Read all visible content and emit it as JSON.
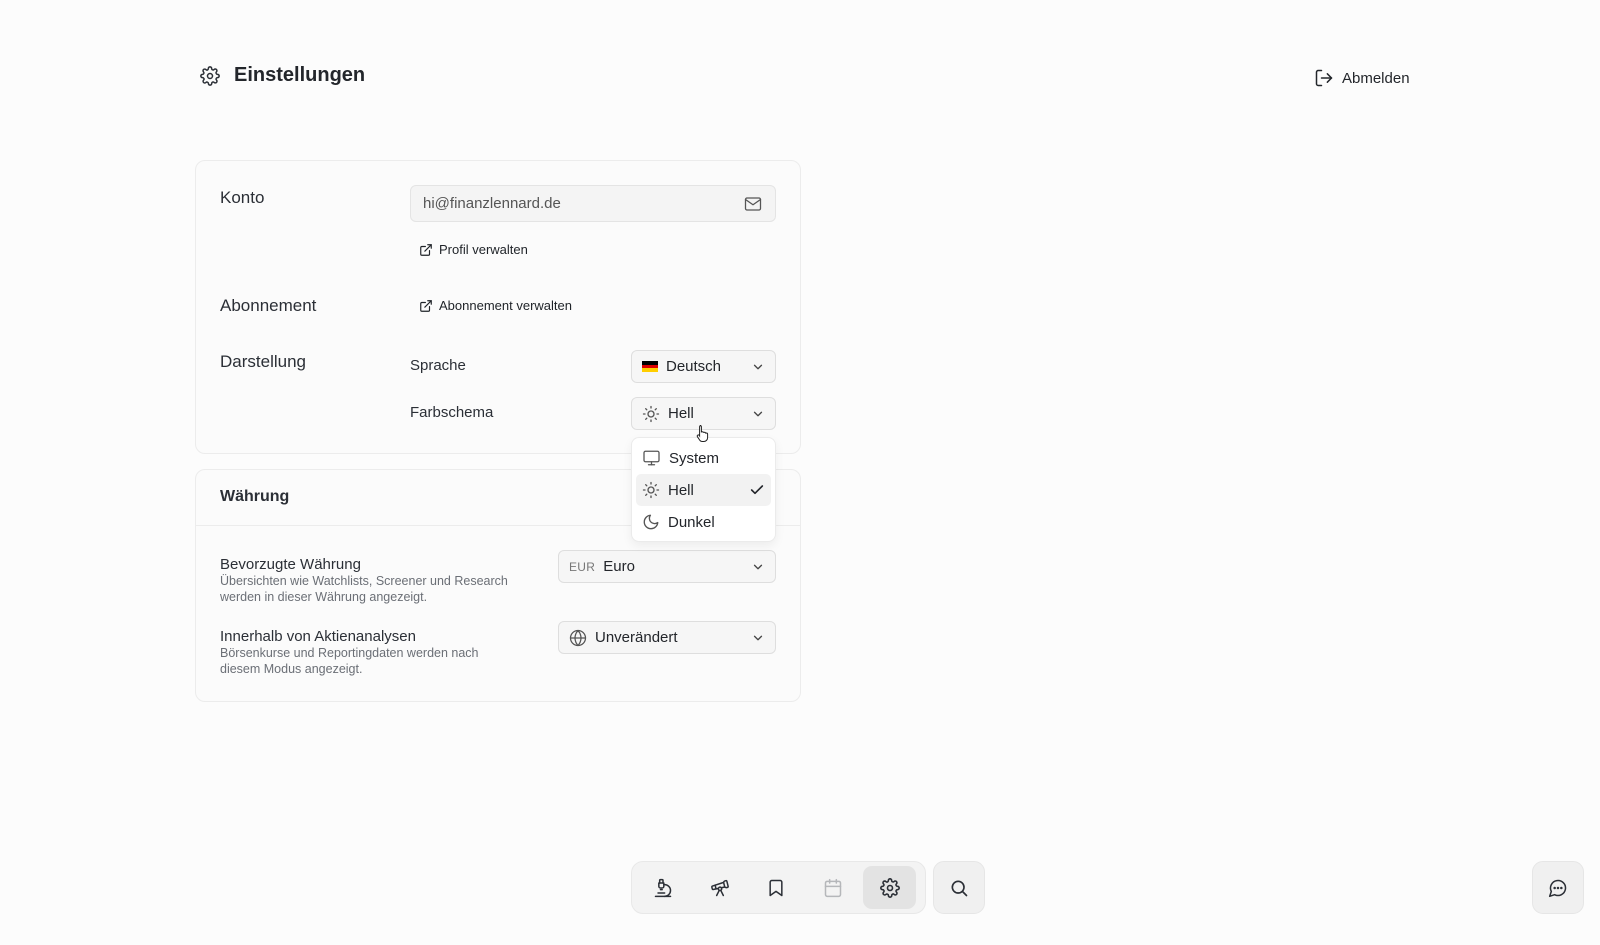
{
  "header": {
    "title": "Einstellungen",
    "logout_label": "Abmelden"
  },
  "account": {
    "section_label": "Konto",
    "email_value": "hi@finanzlennard.de",
    "profile_link": "Profil verwalten"
  },
  "subscription": {
    "section_label": "Abonnement",
    "manage_link": "Abonnement verwalten"
  },
  "appearance": {
    "section_label": "Darstellung",
    "language_label": "Sprache",
    "language_value": "Deutsch",
    "theme_label": "Farbschema",
    "theme_value": "Hell",
    "theme_options": [
      {
        "label": "System",
        "icon": "monitor-icon"
      },
      {
        "label": "Hell",
        "icon": "sun-icon",
        "selected": true
      },
      {
        "label": "Dunkel",
        "icon": "moon-icon"
      }
    ]
  },
  "currency": {
    "section_label": "Währung",
    "preferred_title": "Bevorzugte Währung",
    "preferred_desc": "Übersichten wie Watchlists, Screener und Research werden in dieser Währung angezeigt.",
    "preferred_code": "EUR",
    "preferred_value": "Euro",
    "analysis_title": "Innerhalb von Aktienanalysen",
    "analysis_desc": "Börsenkurse und Reportingdaten werden nach diesem Modus angezeigt.",
    "analysis_value": "Unverändert"
  },
  "dock": {
    "items": [
      "microscope-icon",
      "telescope-icon",
      "bookmark-icon",
      "calendar-icon",
      "gear-icon"
    ],
    "active": "gear-icon"
  },
  "colors": {
    "accent": "#23262b",
    "muted": "#6b6f76",
    "border": "#ececec"
  }
}
